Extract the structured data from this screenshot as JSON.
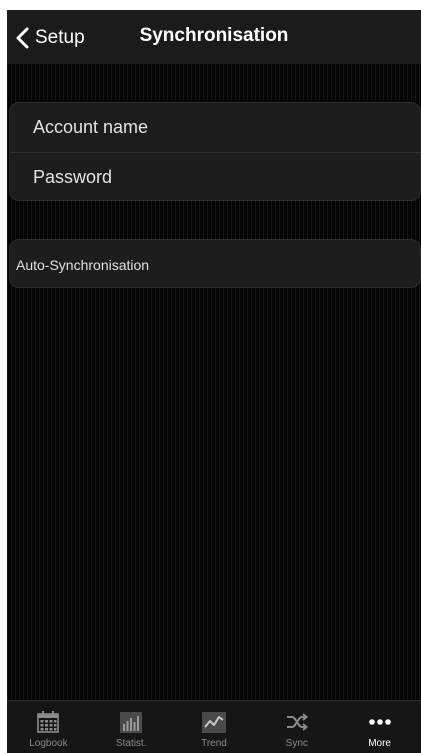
{
  "nav": {
    "back_label": "Setup",
    "title": "Synchronisation"
  },
  "credentials": {
    "account_placeholder": "Account name",
    "password_placeholder": "Password"
  },
  "autosync": {
    "label": "Auto-Synchronisation"
  },
  "tabbar": {
    "active": "More",
    "tabs": [
      {
        "label": "Logbook",
        "icon": "calendar-icon"
      },
      {
        "label": "Statist.",
        "icon": "bar-chart-icon"
      },
      {
        "label": "Trend",
        "icon": "trend-line-icon"
      },
      {
        "label": "Sync",
        "icon": "shuffle-icon"
      },
      {
        "label": "More",
        "icon": "more-dots-icon"
      }
    ]
  },
  "colors": {
    "background": "#050505",
    "navbar": "#1b1b1b",
    "cell": "#1d1d1d",
    "tab_inactive": "#8a8a8a",
    "tab_active": "#ffffff"
  }
}
